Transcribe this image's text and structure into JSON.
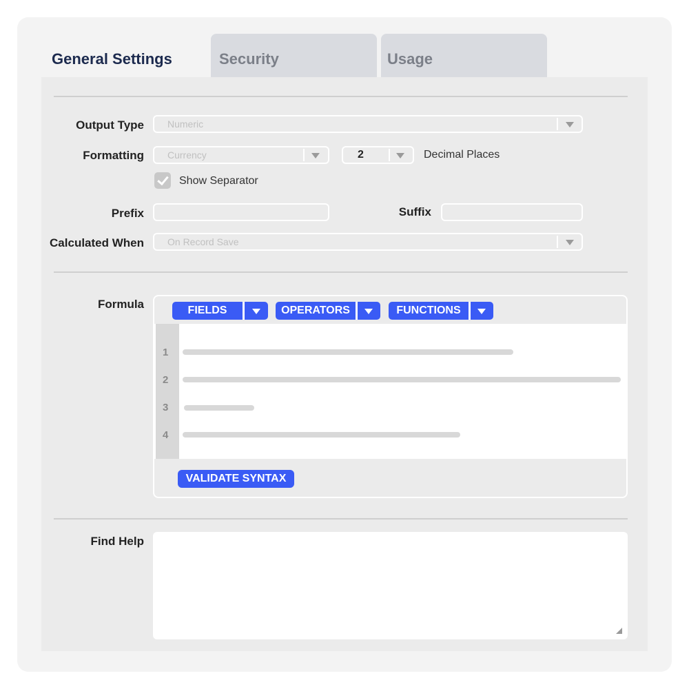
{
  "tabs": {
    "general": "General Settings",
    "security": "Security",
    "usage": "Usage"
  },
  "form": {
    "output_type": {
      "label": "Output Type",
      "value": "Numeric"
    },
    "formatting": {
      "label": "Formatting",
      "value": "Currency",
      "decimals": "2",
      "decimals_label": "Decimal Places"
    },
    "show_separator": {
      "label": "Show Separator",
      "checked": true
    },
    "prefix": {
      "label": "Prefix",
      "value": ""
    },
    "suffix": {
      "label": "Suffix",
      "value": ""
    },
    "calculated_when": {
      "label": "Calculated When",
      "value": "On Record Save"
    }
  },
  "formula": {
    "label": "Formula",
    "toolbar": [
      "FIELDS",
      "OPERATORS",
      "FUNCTIONS"
    ],
    "line_numbers": [
      "1",
      "2",
      "3",
      "4"
    ],
    "validate_label": "VALIDATE SYNTAX"
  },
  "help": {
    "label": "Find Help",
    "value": ""
  },
  "colors": {
    "accent": "#3a5bf5",
    "panel": "#ebebeb",
    "tab_inactive": "#d9dbe0",
    "title": "#1c2a4e"
  },
  "icons": {
    "dropdown": "chevron-down-icon",
    "checkbox": "check-icon",
    "resize": "resize-handle-icon"
  }
}
